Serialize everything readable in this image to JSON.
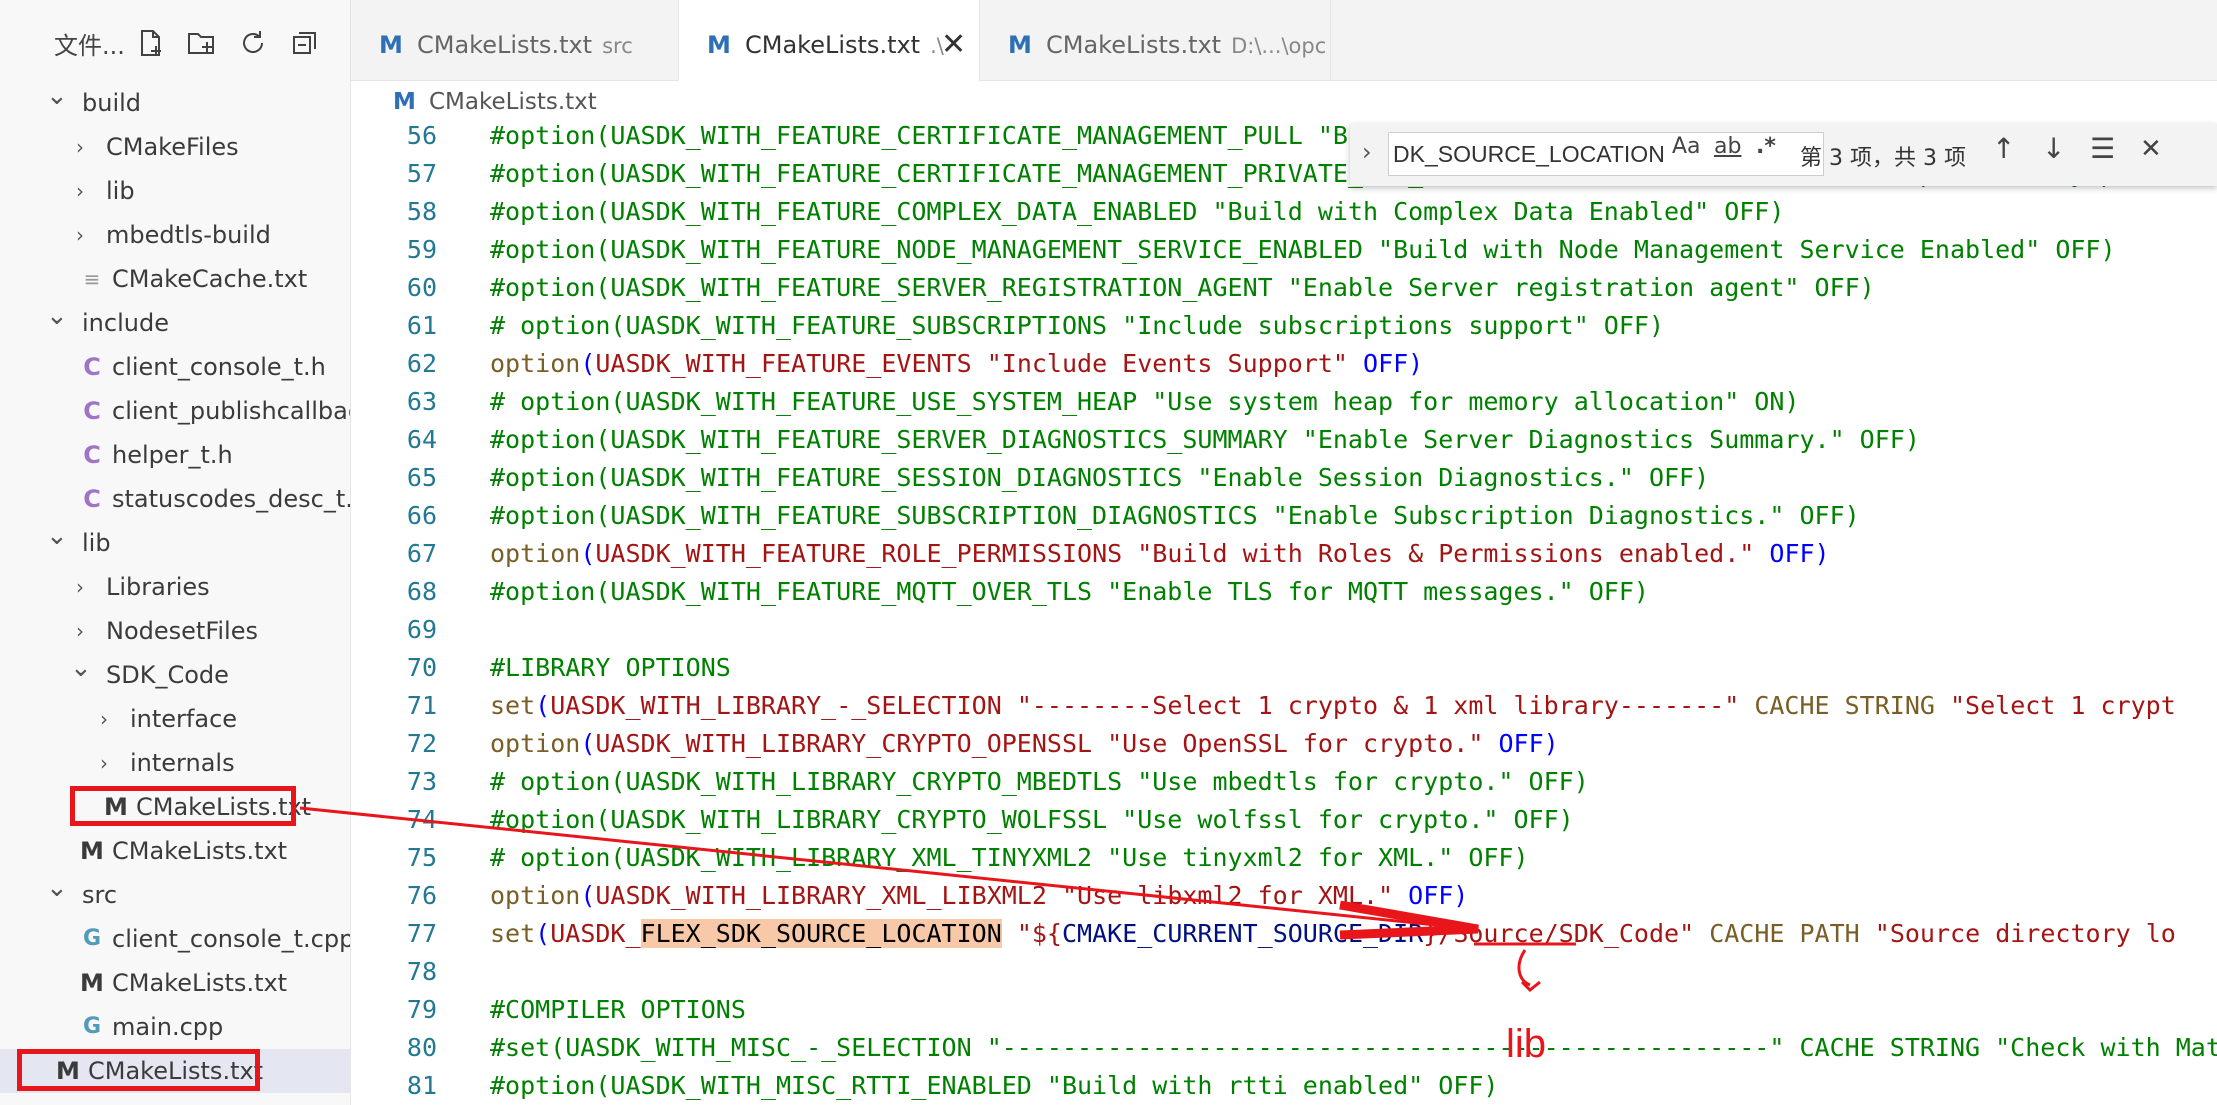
{
  "explorer": {
    "title": "文件...",
    "header_icons": [
      "new-file-icon",
      "new-folder-icon",
      "refresh-icon",
      "collapse-all-icon"
    ],
    "tree": [
      {
        "label": "build",
        "type": "folder",
        "expanded": true,
        "depth": 0
      },
      {
        "label": "CMakeFiles",
        "type": "folder",
        "expanded": false,
        "depth": 1
      },
      {
        "label": "lib",
        "type": "folder",
        "expanded": false,
        "depth": 1
      },
      {
        "label": "mbedtls-build",
        "type": "folder",
        "expanded": false,
        "depth": 1
      },
      {
        "label": "CMakeCache.txt",
        "type": "txt",
        "depth": 1
      },
      {
        "label": "include",
        "type": "folder",
        "expanded": true,
        "depth": 0
      },
      {
        "label": "client_console_t.h",
        "type": "c",
        "depth": 1
      },
      {
        "label": "client_publishcallbac...",
        "type": "c",
        "depth": 1
      },
      {
        "label": "helper_t.h",
        "type": "c",
        "depth": 1
      },
      {
        "label": "statuscodes_desc_t.h",
        "type": "c",
        "depth": 1
      },
      {
        "label": "lib",
        "type": "folder",
        "expanded": true,
        "depth": 0
      },
      {
        "label": "Libraries",
        "type": "folder",
        "expanded": false,
        "depth": 1
      },
      {
        "label": "NodesetFiles",
        "type": "folder",
        "expanded": false,
        "depth": 1
      },
      {
        "label": "SDK_Code",
        "type": "folder",
        "expanded": true,
        "depth": 1
      },
      {
        "label": "interface",
        "type": "folder",
        "expanded": false,
        "depth": 2
      },
      {
        "label": "internals",
        "type": "folder",
        "expanded": false,
        "depth": 2
      },
      {
        "label": "CMakeLists.txt",
        "type": "cmake",
        "depth": 2
      },
      {
        "label": "CMakeLists.txt",
        "type": "cmake",
        "depth": 1
      },
      {
        "label": "src",
        "type": "folder",
        "expanded": true,
        "depth": 0
      },
      {
        "label": "client_console_t.cpp",
        "type": "cpp",
        "depth": 1
      },
      {
        "label": "CMakeLists.txt",
        "type": "cmake",
        "depth": 1
      },
      {
        "label": "main.cpp",
        "type": "cpp",
        "depth": 1
      },
      {
        "label": "CMakeLists.txt",
        "type": "cmake",
        "depth": 0,
        "selected": true
      }
    ],
    "icon_letters": {
      "c": "C",
      "cpp": "G",
      "cmake": "M",
      "txt": "≡"
    }
  },
  "tabs": [
    {
      "icon": "M",
      "name": "CMakeLists.txt",
      "desc": "src",
      "active": false
    },
    {
      "icon": "M",
      "name": "CMakeLists.txt",
      "desc": ".\\",
      "active": true,
      "close": "✕"
    },
    {
      "icon": "M",
      "name": "CMakeLists.txt",
      "desc": "D:\\...\\opc",
      "active": false
    }
  ],
  "breadcrumb": {
    "icon": "M",
    "label": "CMakeLists.txt"
  },
  "find": {
    "toggle": "›",
    "query": "DK_SOURCE_LOCATION",
    "opt_case": "Aa",
    "opt_word": "ab",
    "opt_regex": ".*",
    "count": "第 3 项，共 3 项",
    "prev": "↑",
    "next": "↓",
    "selection": "☰",
    "close": "✕"
  },
  "code": [
    {
      "n": "56",
      "parts": [
        [
          "cmt",
          "#option(UASDK_WITH_FEATURE_CERTIFICATE_MANAGEMENT_PULL \"Build with Certificate Management Pull enabled.\" OFF)"
        ]
      ]
    },
    {
      "n": "57",
      "parts": [
        [
          "cmt",
          "#option(UASDK_WITH_FEATURE_CERTIFICATE_MANAGEMENT_PRIVATE_KEY_PASSWORD \"Build with Certificate private key password te"
        ]
      ]
    },
    {
      "n": "58",
      "parts": [
        [
          "cmt",
          "#option(UASDK_WITH_FEATURE_COMPLEX_DATA_ENABLED \"Build with Complex Data Enabled\" OFF)"
        ]
      ]
    },
    {
      "n": "59",
      "parts": [
        [
          "cmt",
          "#option(UASDK_WITH_FEATURE_NODE_MANAGEMENT_SERVICE_ENABLED \"Build with Node Management Service Enabled\" OFF)"
        ]
      ]
    },
    {
      "n": "60",
      "parts": [
        [
          "cmt",
          "#option(UASDK_WITH_FEATURE_SERVER_REGISTRATION_AGENT \"Enable Server registration agent\" OFF)"
        ]
      ]
    },
    {
      "n": "61",
      "parts": [
        [
          "cmt",
          "# option(UASDK_WITH_FEATURE_SUBSCRIPTIONS \"Include subscriptions support\" OFF)"
        ]
      ]
    },
    {
      "n": "62",
      "parts": [
        [
          "kw",
          "option"
        ],
        [
          "off",
          "("
        ],
        [
          "var",
          "UASDK_WITH_FEATURE_EVENTS "
        ],
        [
          "str",
          "\"Include Events Support\" "
        ],
        [
          "off",
          "OFF)"
        ]
      ]
    },
    {
      "n": "63",
      "parts": [
        [
          "cmt",
          "# option(UASDK_WITH_FEATURE_USE_SYSTEM_HEAP \"Use system heap for memory allocation\" ON)"
        ]
      ]
    },
    {
      "n": "64",
      "parts": [
        [
          "cmt",
          "#option(UASDK_WITH_FEATURE_SERVER_DIAGNOSTICS_SUMMARY \"Enable Server Diagnostics Summary.\" OFF)"
        ]
      ]
    },
    {
      "n": "65",
      "parts": [
        [
          "cmt",
          "#option(UASDK_WITH_FEATURE_SESSION_DIAGNOSTICS \"Enable Session Diagnostics.\" OFF)"
        ]
      ]
    },
    {
      "n": "66",
      "parts": [
        [
          "cmt",
          "#option(UASDK_WITH_FEATURE_SUBSCRIPTION_DIAGNOSTICS \"Enable Subscription Diagnostics.\" OFF)"
        ]
      ]
    },
    {
      "n": "67",
      "parts": [
        [
          "kw",
          "option"
        ],
        [
          "off",
          "("
        ],
        [
          "var",
          "UASDK_WITH_FEATURE_ROLE_PERMISSIONS "
        ],
        [
          "str",
          "\"Build with Roles & Permissions enabled.\" "
        ],
        [
          "off",
          "OFF)"
        ]
      ]
    },
    {
      "n": "68",
      "parts": [
        [
          "cmt",
          "#option(UASDK_WITH_FEATURE_MQTT_OVER_TLS \"Enable TLS for MQTT messages.\" OFF)"
        ]
      ]
    },
    {
      "n": "69",
      "parts": []
    },
    {
      "n": "70",
      "parts": [
        [
          "cmt",
          "#LIBRARY OPTIONS"
        ]
      ]
    },
    {
      "n": "71",
      "parts": [
        [
          "kw",
          "set"
        ],
        [
          "off",
          "("
        ],
        [
          "var",
          "UASDK_WITH_LIBRARY_-_SELECTION "
        ],
        [
          "str",
          "\"--------Select 1 crypto & 1 xml library-------\" "
        ],
        [
          "kw",
          "CACHE STRING "
        ],
        [
          "str",
          "\"Select 1 crypt"
        ]
      ]
    },
    {
      "n": "72",
      "parts": [
        [
          "kw",
          "option"
        ],
        [
          "off",
          "("
        ],
        [
          "var",
          "UASDK_WITH_LIBRARY_CRYPTO_OPENSSL "
        ],
        [
          "str",
          "\"Use OpenSSL for crypto.\" "
        ],
        [
          "off",
          "OFF)"
        ]
      ]
    },
    {
      "n": "73",
      "parts": [
        [
          "cmt",
          "# option(UASDK_WITH_LIBRARY_CRYPTO_MBEDTLS \"Use mbedtls for crypto.\" OFF)"
        ]
      ]
    },
    {
      "n": "74",
      "parts": [
        [
          "cmt",
          "#option(UASDK_WITH_LIBRARY_CRYPTO_WOLFSSL \"Use wolfssl for crypto.\" OFF)"
        ]
      ]
    },
    {
      "n": "75",
      "parts": [
        [
          "cmt",
          "# option(UASDK_WITH_LIBRARY_XML_TINYXML2 \"Use tinyxml2 for XML.\" OFF)"
        ]
      ]
    },
    {
      "n": "76",
      "parts": [
        [
          "kw",
          "option"
        ],
        [
          "off",
          "("
        ],
        [
          "var",
          "UASDK_WITH_LIBRARY_XML_LIBXML2 "
        ],
        [
          "str",
          "\"Use libxml2 for XML.\" "
        ],
        [
          "off",
          "OFF)"
        ]
      ]
    },
    {
      "n": "77",
      "parts": [
        [
          "kw",
          "set"
        ],
        [
          "off",
          "("
        ],
        [
          "var",
          "UASDK_"
        ],
        [
          "match",
          "FLEX_SDK_SOURCE_LOCATION"
        ],
        [
          "var",
          " "
        ],
        [
          "str",
          "\"${"
        ],
        [
          "cvar",
          "CMAKE_CURRENT_SOURCE_DIR"
        ],
        [
          "str",
          "}/Source/SDK_Code\" "
        ],
        [
          "kw",
          "CACHE PATH "
        ],
        [
          "str",
          "\"Source directory lo"
        ]
      ]
    },
    {
      "n": "78",
      "parts": []
    },
    {
      "n": "79",
      "parts": [
        [
          "cmt",
          "#COMPILER OPTIONS"
        ]
      ]
    },
    {
      "n": "80",
      "parts": [
        [
          "cmt",
          "#set(UASDK_WITH_MISC_-_SELECTION \"---------------------------------------------------\" CACHE STRING \"Check with Mat"
        ]
      ]
    },
    {
      "n": "81",
      "parts": [
        [
          "cmt",
          "#option(UASDK_WITH_MISC_RTTI_ENABLED \"Build with rtti enabled\" OFF)"
        ]
      ]
    }
  ],
  "annotations": {
    "note_text": "lib",
    "color": "#e8151b"
  },
  "colors": {
    "comment": "#008000",
    "keyword": "#795e26",
    "string": "#a31515",
    "constant": "#0000ff",
    "line_number": "#237893",
    "match_bg": "#f8c9a8"
  }
}
